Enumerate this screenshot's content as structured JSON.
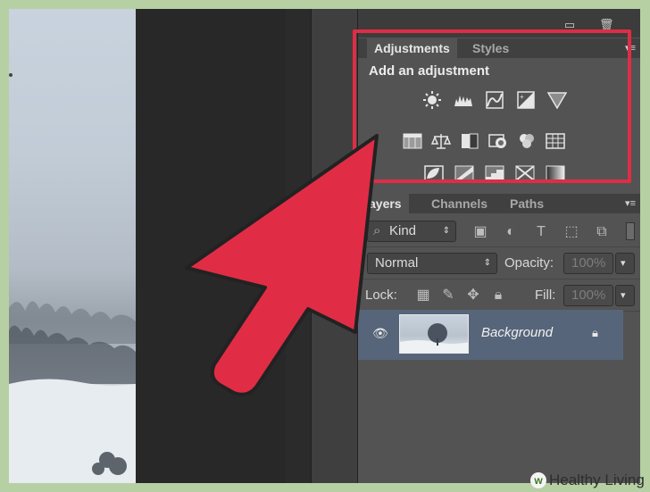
{
  "adjustments_panel": {
    "tabs": [
      {
        "label": "Adjustments",
        "active": true
      },
      {
        "label": "Styles",
        "active": false
      }
    ],
    "title": "Add an adjustment",
    "icon_rows": [
      [
        "brightness-contrast-icon",
        "levels-icon",
        "curves-icon",
        "exposure-icon",
        "vibrance-icon"
      ],
      [
        "hue-saturation-icon",
        "color-balance-icon",
        "black-white-icon",
        "photo-filter-icon",
        "channel-mixer-icon",
        "color-lookup-icon"
      ],
      [
        "invert-icon",
        "posterize-icon",
        "threshold-icon",
        "selective-color-icon",
        "gradient-map-icon"
      ]
    ]
  },
  "layers_panel": {
    "tabs": [
      {
        "label": "ayers",
        "active": true
      },
      {
        "label": "Channels",
        "active": false
      },
      {
        "label": "Paths",
        "active": false
      }
    ],
    "filter_kind": "Kind",
    "blend_mode": "Normal",
    "opacity_label": "Opacity:",
    "opacity_value": "100%",
    "lock_label": "Lock:",
    "fill_label": "Fill:",
    "fill_value": "100%",
    "layer_name": "Background"
  },
  "watermark": {
    "text": "Healthy Living",
    "badge": "w"
  },
  "colors": {
    "highlight_box": "#e02d45",
    "arrow_fill": "#e02d45",
    "panel_bg": "#535353",
    "border": "#b6d0a4"
  }
}
